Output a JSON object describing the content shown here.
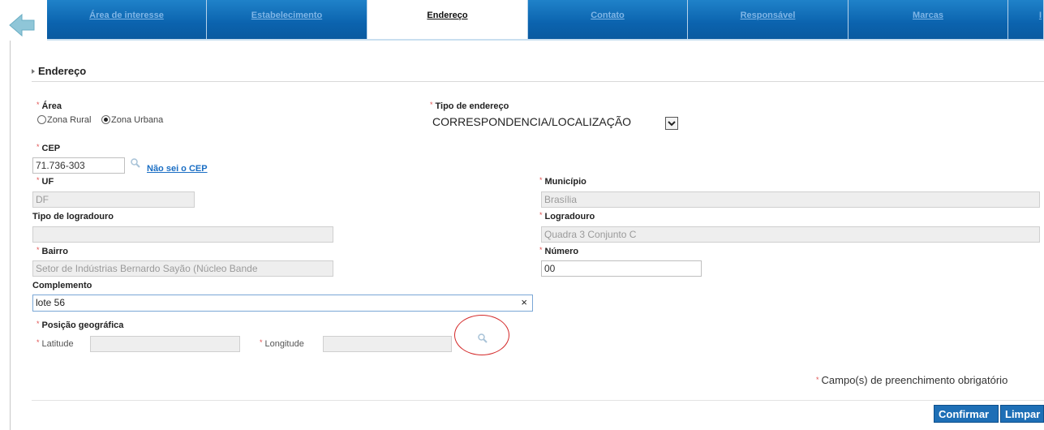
{
  "tabs": [
    {
      "label": "Área de interesse",
      "active": false
    },
    {
      "label": "Estabelecimento",
      "active": false
    },
    {
      "label": "Endereço",
      "active": true
    },
    {
      "label": "Contato",
      "active": false
    },
    {
      "label": "Responsável",
      "active": false
    },
    {
      "label": "Marcas",
      "active": false
    },
    {
      "label": "I",
      "active": false
    }
  ],
  "section": {
    "title": "Endereço"
  },
  "required_mark": "*",
  "area": {
    "label": "Área",
    "options": [
      {
        "label": "Zona Rural",
        "selected": false
      },
      {
        "label": "Zona Urbana",
        "selected": true
      }
    ]
  },
  "tipo_endereco": {
    "label": "Tipo de endereço",
    "value": "CORRESPONDENCIA/LOCALIZAÇÃO"
  },
  "cep": {
    "label": "CEP",
    "value": "71.736-303",
    "link": "Não sei o CEP"
  },
  "uf": {
    "label": "UF",
    "value": "DF"
  },
  "municipio": {
    "label": "Município",
    "value": "Brasília"
  },
  "tipo_logradouro": {
    "label": "Tipo de logradouro",
    "value": ""
  },
  "logradouro": {
    "label": "Logradouro",
    "value": "Quadra 3 Conjunto C"
  },
  "bairro": {
    "label": "Bairro",
    "value": "Setor de Indústrias Bernardo Sayão (Núcleo Bande"
  },
  "numero": {
    "label": "Número",
    "value": "00"
  },
  "complemento": {
    "label": "Complemento",
    "value": "lote 56",
    "clear": "×"
  },
  "posicao": {
    "label": "Posição geográfica",
    "latitude_label": "Latitude",
    "latitude_value": "",
    "longitude_label": "Longitude",
    "longitude_value": ""
  },
  "required_note": "Campo(s) de preenchimento obrigatório",
  "buttons": {
    "confirm": "Confirmar",
    "clear": "Limpar"
  },
  "colors": {
    "tab_bg": "#0b63ae",
    "accent": "#1e6fb6",
    "required": "#e05050",
    "highlight_circle": "#d42a2a"
  }
}
